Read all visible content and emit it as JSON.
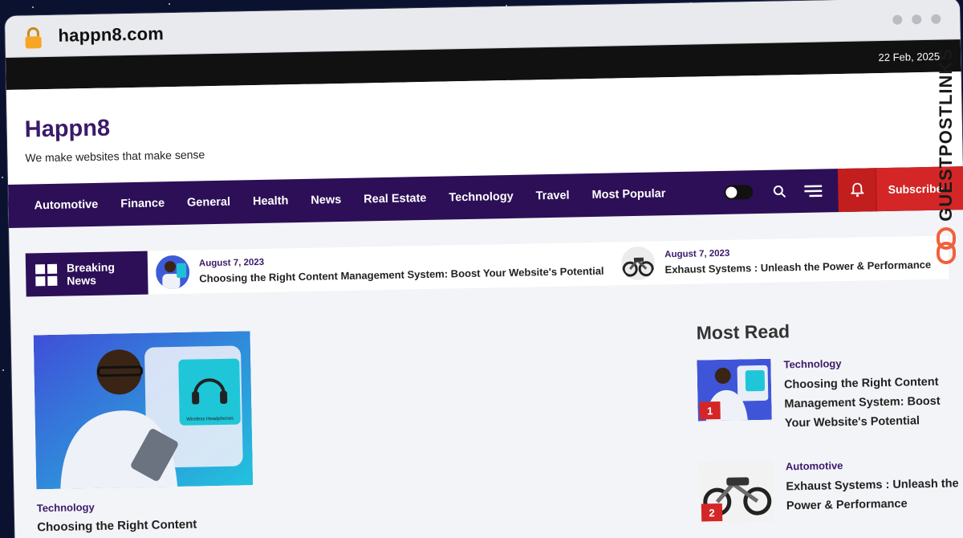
{
  "browser": {
    "url": "happn8.com"
  },
  "topbar": {
    "date": "22 Feb, 2025"
  },
  "site": {
    "title": "Happn8",
    "tagline": "We make websites that make sense"
  },
  "nav": {
    "items": [
      "Automotive",
      "Finance",
      "General",
      "Health",
      "News",
      "Real Estate",
      "Technology",
      "Travel",
      "Most Popular"
    ],
    "subscribe_label": "Subscribe"
  },
  "breaking": {
    "label": "Breaking News",
    "items": [
      {
        "date": "August 7, 2023",
        "title": "Choosing the Right Content Management System: Boost Your Website's Potential"
      },
      {
        "date": "August 7, 2023",
        "title": "Exhaust Systems : Unleash the Power & Performance"
      }
    ]
  },
  "feature": {
    "category": "Technology",
    "title": "Choosing the Right Content",
    "image_caption": "Wireless Headphones"
  },
  "most_read": {
    "heading": "Most Read",
    "items": [
      {
        "rank": "1",
        "category": "Technology",
        "title": "Choosing the Right Content Management System: Boost Your Website's Potential"
      },
      {
        "rank": "2",
        "category": "Automotive",
        "title": "Exhaust Systems : Unleash the Power & Performance"
      }
    ]
  },
  "badge": {
    "text": "GUESTPOSTLINKS"
  },
  "colors": {
    "brand_purple": "#2d0f57",
    "accent_red": "#d42626",
    "topbar_black": "#111111"
  }
}
